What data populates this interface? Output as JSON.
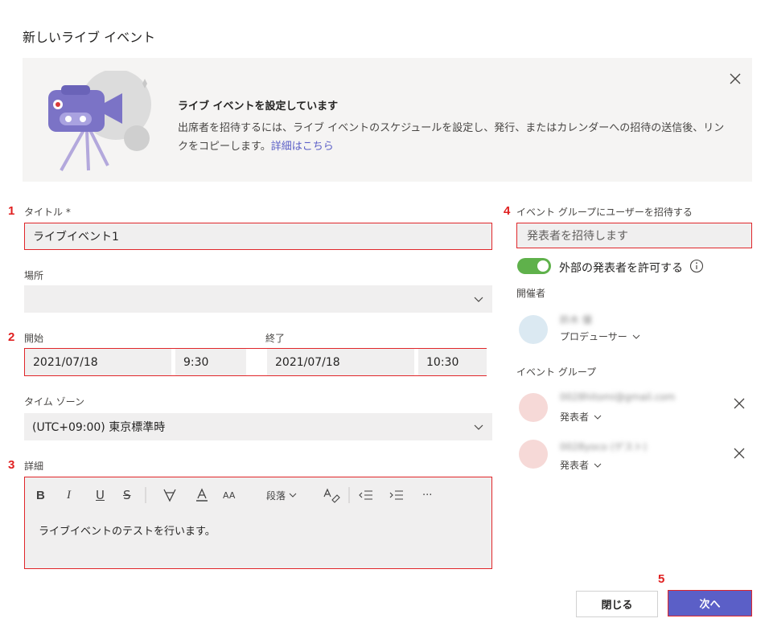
{
  "dialog": {
    "title": "新しいライブ イベント"
  },
  "banner": {
    "heading": "ライブ イベントを設定しています",
    "description": "出席者を招待するには、ライブ イベントのスケジュールを設定し、発行、またはカレンダーへの招待の送信後、リンクをコピーします。",
    "link": "詳細はこちら"
  },
  "markers": [
    "1",
    "2",
    "3",
    "4",
    "5"
  ],
  "form": {
    "title": {
      "label": "タイトル *",
      "value": "ライブイベント1"
    },
    "location": {
      "label": "場所",
      "value": ""
    },
    "start": {
      "label": "開始",
      "date": "2021/07/18",
      "time": "9:30"
    },
    "end": {
      "label": "終了",
      "date": "2021/07/18",
      "time": "10:30"
    },
    "timezone": {
      "label": "タイム ゾーン",
      "value": "(UTC+09:00) 東京標準時"
    },
    "details": {
      "label": "詳細",
      "toolbar": {
        "bold": "B",
        "italic": "I",
        "underline": "U",
        "strikethrough": "S",
        "font_size": "AA",
        "paragraph": "段落",
        "more": "···"
      },
      "body": "ライブイベントのテストを行います。"
    }
  },
  "invite": {
    "label": "イベント グループにユーザーを招待する",
    "placeholder": "発表者を招待します",
    "allow_external": {
      "label": "外部の発表者を許可する",
      "enabled": true
    },
    "organizer_heading": "開催者",
    "organizer": {
      "name": "鈴木 優",
      "role": "プロデューサー"
    },
    "group_heading": "イベント グループ",
    "members": [
      {
        "name": "0028hitomi@gmail.com",
        "role": "発表者"
      },
      {
        "name": "0028yoco (ゲスト)",
        "role": "発表者"
      }
    ]
  },
  "buttons": {
    "close": "閉じる",
    "next": "次へ"
  },
  "colors": {
    "accent": "#5b5fc7",
    "highlight": "#e0262a",
    "toggle_on": "#5fb14b",
    "field_bg": "#f0efef",
    "banner_bg": "#f5f4f3"
  }
}
